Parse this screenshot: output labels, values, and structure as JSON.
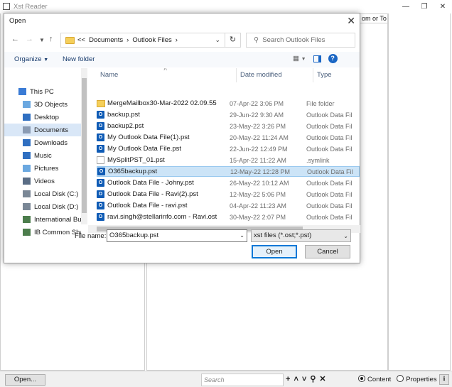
{
  "app": {
    "title": "Xst Reader",
    "column_header": "om or To",
    "open_button": "Open...",
    "search_placeholder": "Search",
    "status_icons": [
      "+",
      "^",
      "v",
      "search",
      "x"
    ],
    "radio_content": "Content",
    "radio_properties": "Properties",
    "info_button": "i"
  },
  "dialog": {
    "title": "Open",
    "breadcrumb_prefix": "<<",
    "breadcrumb": [
      "Documents",
      "Outlook Files"
    ],
    "search_placeholder": "Search Outlook Files",
    "organize": "Organize",
    "new_folder": "New folder",
    "nav_items": [
      {
        "label": "This PC",
        "icon": "computer-icon"
      },
      {
        "label": "3D Objects",
        "icon": "cube-icon"
      },
      {
        "label": "Desktop",
        "icon": "desktop-icon"
      },
      {
        "label": "Documents",
        "icon": "documents-icon",
        "selected": true
      },
      {
        "label": "Downloads",
        "icon": "download-icon"
      },
      {
        "label": "Music",
        "icon": "music-icon"
      },
      {
        "label": "Pictures",
        "icon": "pictures-icon"
      },
      {
        "label": "Videos",
        "icon": "video-icon"
      },
      {
        "label": "Local Disk (C:)",
        "icon": "drive-icon"
      },
      {
        "label": "Local Disk (D:)",
        "icon": "drive-icon"
      },
      {
        "label": "International Bus",
        "icon": "network-drive-icon"
      },
      {
        "label": "IB Common Sha",
        "icon": "network-drive-icon"
      }
    ],
    "columns": {
      "name": "Name",
      "date": "Date modified",
      "type": "Type"
    },
    "files": [
      {
        "name": "MergeMailbox30-Mar-2022 02.09.55",
        "date": "07-Apr-22 3:06 PM",
        "type": "File folder",
        "kind": "folder"
      },
      {
        "name": "backup.pst",
        "date": "29-Jun-22 9:30 AM",
        "type": "Outlook Data Fil",
        "kind": "pst"
      },
      {
        "name": "backup2.pst",
        "date": "23-May-22 3:26 PM",
        "type": "Outlook Data Fil",
        "kind": "pst"
      },
      {
        "name": "My Outlook Data File(1).pst",
        "date": "20-May-22 11:24 AM",
        "type": "Outlook Data Fil",
        "kind": "pst"
      },
      {
        "name": "My Outlook Data File.pst",
        "date": "22-Jun-22 12:49 PM",
        "type": "Outlook Data Fil",
        "kind": "pst"
      },
      {
        "name": "MySplitPST_01.pst",
        "date": "15-Apr-22 11:22 AM",
        "type": ".symlink",
        "kind": "link"
      },
      {
        "name": "O365backup.pst",
        "date": "12-May-22 12:28 PM",
        "type": "Outlook Data Fil",
        "kind": "pst",
        "selected": true
      },
      {
        "name": "Outlook Data File - Johny.pst",
        "date": "26-May-22 10:12 AM",
        "type": "Outlook Data Fil",
        "kind": "pst"
      },
      {
        "name": "Outlook Data File - Ravi(2).pst",
        "date": "12-May-22 5:06 PM",
        "type": "Outlook Data Fil",
        "kind": "pst"
      },
      {
        "name": "Outlook Data File - ravi.pst",
        "date": "04-Apr-22 11:23 AM",
        "type": "Outlook Data Fil",
        "kind": "pst"
      },
      {
        "name": "ravi.singh@stellarinfo.com - Ravi.ost",
        "date": "30-May-22 2:07 PM",
        "type": "Outlook Data Fil",
        "kind": "pst"
      }
    ],
    "file_name_label": "File name:",
    "file_name_value": "O365backup.pst",
    "file_type": "xst files (*.ost;*.pst)",
    "open_button": "Open",
    "cancel_button": "Cancel"
  },
  "colors": {
    "selection": "#cce4f7",
    "accent": "#0078d7",
    "folder": "#f5cf5a",
    "outlook": "#0f5bb5"
  }
}
